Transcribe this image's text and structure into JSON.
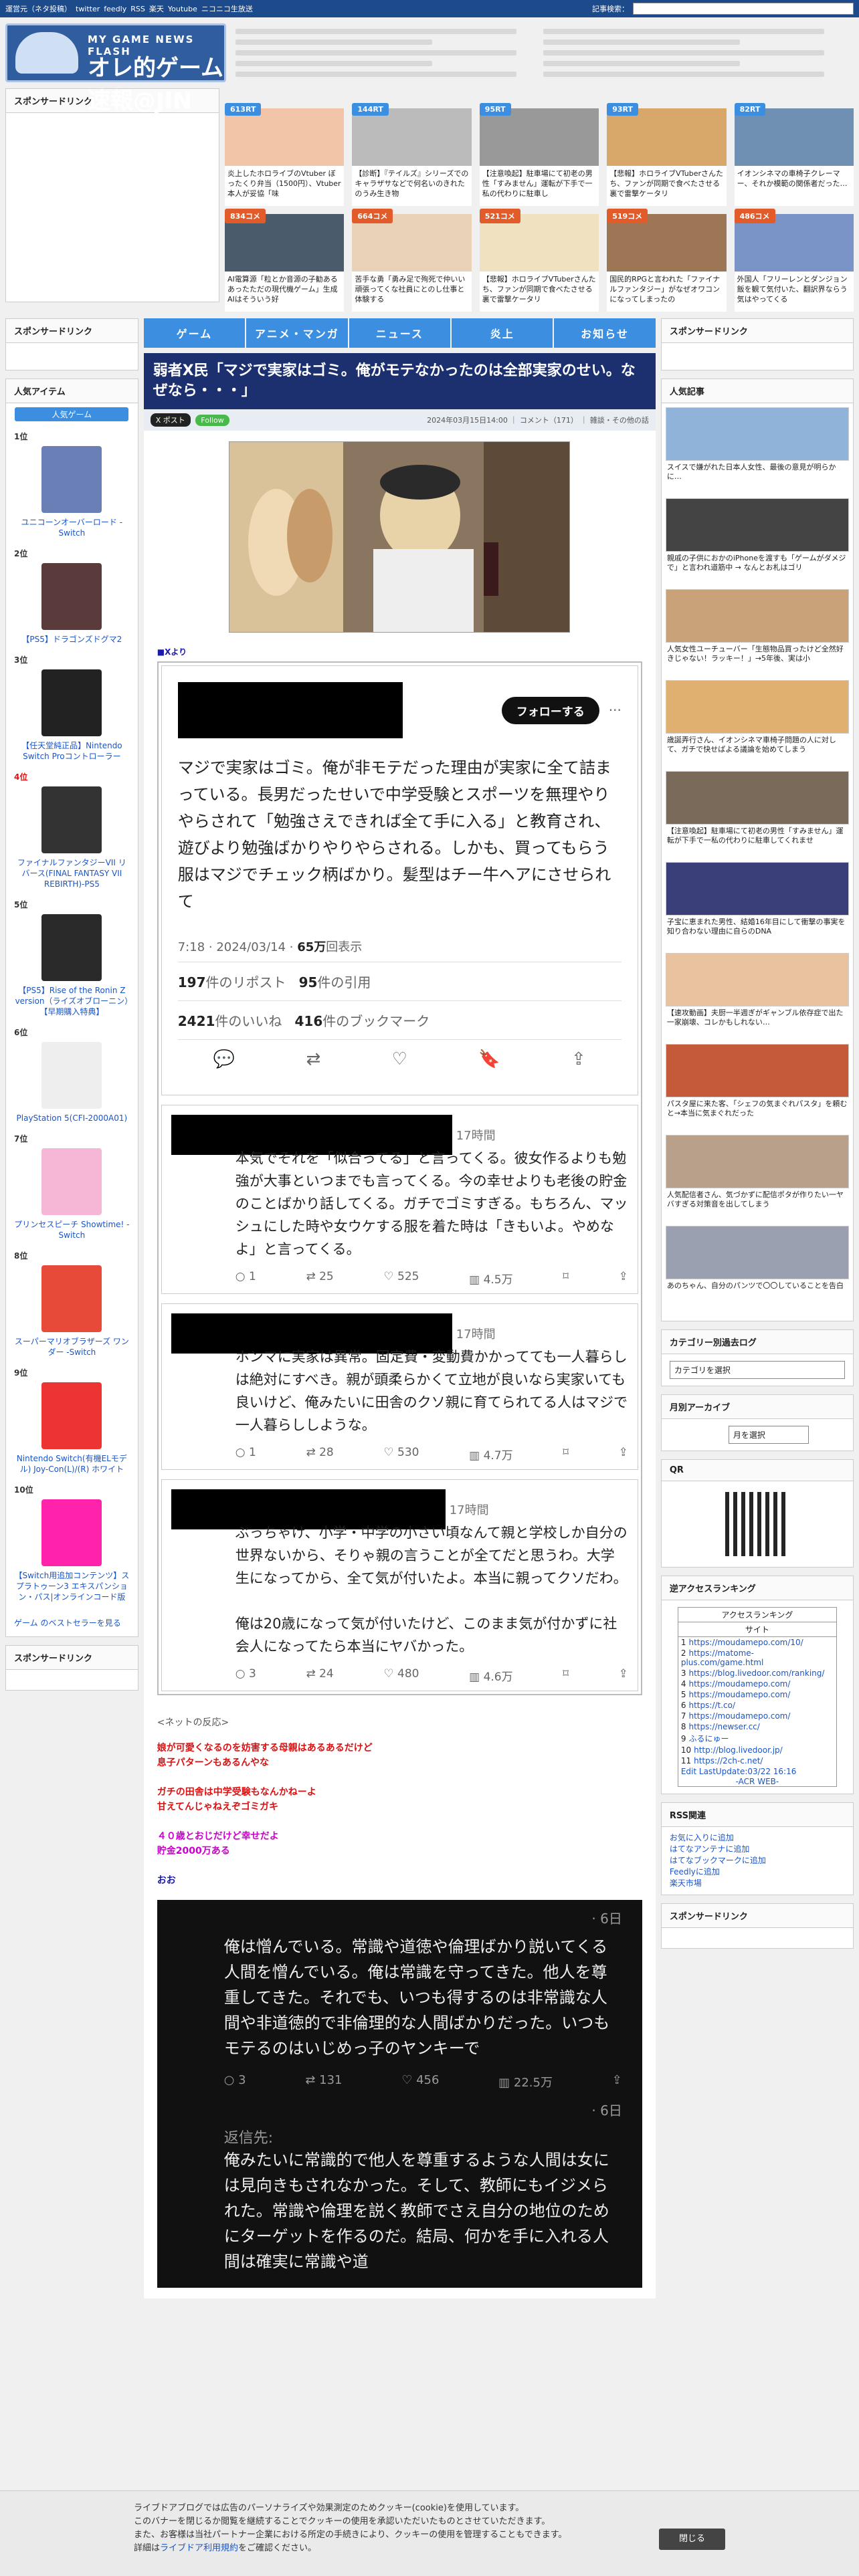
{
  "topbar": {
    "links": [
      "運営元（ネタ投稿）",
      "twitter",
      "feedly",
      "RSS",
      "楽天",
      "Youtube",
      "ニコニコ生放送"
    ],
    "search_label": "記事検索："
  },
  "logo": {
    "sub": "MY GAME NEWS FLASH",
    "main": "オレ的ゲーム速報@JIN"
  },
  "sponsored_left": "スポンサードリンク",
  "antenna": [
    {
      "badge": "613RT",
      "text": "炎上したホロライブのVtuber ぼったくり弁当（1500円）、Vtuber本人が妥協「味",
      "color": "blue"
    },
    {
      "badge": "144RT",
      "text": "【診断】『テイルズ』シリーズでのキャラザサなどで何名いのきれたのうみ生き物",
      "color": "blue"
    },
    {
      "badge": "95RT",
      "text": "【注意喚起】駐車場にて初老の男性「すみません」運転が下手で一私の代わりに駐車し",
      "color": "blue"
    },
    {
      "badge": "93RT",
      "text": "【悲報】ホロライブVTuberさんたち、ファンが同期で食べたさせる裏で雷撃ケータリ",
      "color": "blue"
    },
    {
      "badge": "82RT",
      "text": "イオンシネマの車椅子クレーマー、それか模範の関係者だった…",
      "color": "blue"
    },
    {
      "badge": "834コメ",
      "text": "AI電算源「粒とか音源の子勧あるあったただの現代機ゲーム」生成AIはそういう好",
      "color": "red"
    },
    {
      "badge": "664コメ",
      "text": "苦手な勇「勇み足で殉死で仲いい頑張ってくな社員にとのし仕事と体験する",
      "color": "red"
    },
    {
      "badge": "521コメ",
      "text": "【悲報】ホロライブVTuberさんたち、ファンが同期で食べたさせる裏で雷撃ケータリ",
      "color": "red"
    },
    {
      "badge": "519コメ",
      "text": "国民的RPGと言われた「ファイナルファンタジー」がなぜオワコンになってしまったの",
      "color": "red"
    },
    {
      "badge": "486コメ",
      "text": "外国人「フリーレンとダンジョン飯を観て気付いた、翻訳界ならう気はやってくる",
      "color": "red"
    }
  ],
  "nav": [
    "ゲーム",
    "アニメ・マンガ",
    "ニュース",
    "炎上",
    "お知らせ"
  ],
  "sidebar_left": {
    "sponsored": "スポンサードリンク",
    "popular_title": "人気アイテム",
    "hot_tab": "人気ゲーム",
    "ranking": [
      {
        "no": "1位",
        "name": "ユニコーンオーバーロード -Switch"
      },
      {
        "no": "2位",
        "name": "【PS5】ドラゴンズドグマ2"
      },
      {
        "no": "3位",
        "name": "【任天堂純正品】Nintendo Switch Proコントローラー"
      },
      {
        "no": "4位",
        "name": "ファイナルファンタジーVII リバース(FINAL FANTASY VII REBIRTH)-PS5"
      },
      {
        "no": "5位",
        "name": "【PS5】Rise of the Ronin Z version（ライズオブローニン）【早期購入特典】"
      },
      {
        "no": "6位",
        "name": "PlayStation 5(CFI-2000A01)"
      },
      {
        "no": "7位",
        "name": "プリンセスピーチ Showtime! -Switch"
      },
      {
        "no": "8位",
        "name": "スーパーマリオブラザーズ ワンダー -Switch"
      },
      {
        "no": "9位",
        "name": "Nintendo Switch(有機ELモデル) Joy-Con(L)/(R) ホワイト"
      },
      {
        "no": "10位",
        "name": "【Switch用追加コンテンツ】スプラトゥーン3 エキスパンション・パス|オンラインコード版"
      }
    ],
    "best_seller": "ゲーム のベストセラーを見る",
    "sponsored2": "スポンサードリンク"
  },
  "article": {
    "title": "弱者X民「マジで実家はゴミ。俺がモテなかったのは全部実家のせい。なぜなら・・・」",
    "btn_x": "X ポスト",
    "btn_follow": "Follow",
    "meta": "2024年03月15日14:00 ｜ コメント（171） ｜ 雑談・その他の話",
    "xfrom": "■Xより",
    "tweet": {
      "follow": "フォローする",
      "body": "マジで実家はゴミ。俺が非モテだった理由が実家に全て詰まっている。長男だったせいで中学受験とスポーツを無理やりやらされて「勉強さえできれば全て手に入る」と教育され、遊びより勉強ばかりやりやらされる。しかも、買ってもらう服はマジでチェック柄ばかり。髪型はチー牛ヘアにさせられて",
      "time": "7:18 · 2024/03/14 · ",
      "views": "65万",
      "views_label": "回表示",
      "reposts": "197",
      "reposts_label": "件のリポスト",
      "quotes": "95",
      "quotes_label": "件の引用",
      "likes": "2421",
      "likes_label": "件のいいね",
      "bookmarks": "416",
      "bookmarks_label": "件のブックマーク"
    },
    "replies": [
      {
        "time": "17時間",
        "body": "本気でそれを「似合ってる」と言ってくる。彼女作るよりも勉強が大事といつまでも言ってくる。今の幸せよりも老後の貯金のことばかり話してくる。ガチでゴミすぎる。もちろん、マッシュにした時や女ウケする服を着た時は「きもいよ。やめなよ」と言ってくる。",
        "c": "1",
        "rt": "25",
        "lk": "525",
        "v": "4.5万"
      },
      {
        "time": "17時間",
        "body": "ホンマに実家は異常。固定費・変動費かかってても一人暮らしは絶対にすべき。親が頭柔らかくて立地が良いなら実家いても良いけど、俺みたいに田舎のクソ親に育てられてる人はマジで一人暮らししような。",
        "c": "1",
        "rt": "28",
        "lk": "530",
        "v": "4.7万"
      },
      {
        "time": "17時間",
        "body": "ぶっちゃけ、小学・中学の小さい頃なんて親と学校しか自分の世界ないから、そりゃ親の言うことが全てだと思うわ。大学生になってから、全て気が付いたよ。本当に親ってクソだわ。\n\n俺は20歳になって気が付いたけど、このまま気が付かずに社会人になってたら本当にヤバかった。",
        "c": "3",
        "rt": "24",
        "lk": "480",
        "v": "4.6万"
      }
    ],
    "reactions_header": "<ネットの反応>",
    "reactions": [
      {
        "text": "娘が可愛くなるのを妨害する母親はあるあるだけど\n息子パターンもあるんやな",
        "color": "red"
      },
      {
        "text": "ガチの田舎は中学受験もなんかねーよ\n甘えてんじゃねえぞゴミガキ",
        "color": "red"
      },
      {
        "text": "４０歳とおじだけど幸せだよ\n貯金2000万ある",
        "color": "mag"
      },
      {
        "text": "おお",
        "color": "blue"
      }
    ],
    "dark_tweet": {
      "time": "· 6日",
      "body": "俺は憎んでいる。常識や道徳や倫理ばかり説いてくる人間を憎んでいる。俺は常識を守ってきた。他人を尊重してきた。それでも、いつも得するのは非常識な人間や非道徳的で非倫理的な人間ばかりだった。いつもモテるのはいじめっ子のヤンキーで",
      "c": "3",
      "rt": "131",
      "lk": "456",
      "v": "22.5万",
      "time2": "· 6日",
      "sub": "返信先:",
      "body2": "俺みたいに常識的で他人を尊重するような人間は女には見向きもされなかった。そして、教師にもイジメられた。常識や倫理を説く教師でさえ自分の地位のためにターゲットを作るのだ。結局、何かを手に入れる人間は確実に常識や道"
    }
  },
  "sidebar_right": {
    "sponsored": "スポンサードリンク",
    "popular_title": "人気記事",
    "popular": [
      "スイスで嫌がれた日本人女性、最後の意見が明らかに…",
      "親戚の子供におかのiPhoneを渡すも「ゲームがダメジで」と言われ道筋中 → なんとお札はゴリ",
      "人気女性ユーチューバー「生態物品買ったけど全然好きじゃない！ラッキー！」→5年後、実は小",
      "歳誕弄行さん、イオンシネマ車椅子問題の人に対して、ガチで快せばよる議論を始めてしまう",
      "【注意喚起】駐車場にて初老の男性「すみません」運転が下手で一私の代わりに駐車してくれませ",
      "子宝に恵まれた男性、結婚16年目にして衝撃の事実を知り合わない理由に自らのDNA",
      "【速攻動画】夫厨一半週ぎがギャンブル依存症で出た一家崩壊、コレかもしれない…",
      "パスタ屋に来た客、「シェフの気まぐれパスタ」を頼むと→本当に気まぐれだった",
      "人気配信者さん、気づかずに配信ポタが作りたい一ヤバすぎる対策音を出してしまう",
      "あのちゃん、自分のパンツで〇〇していることを告白"
    ],
    "category_title": "カテゴリー別過去ログ",
    "category_select": "カテゴリを選択",
    "monthly_title": "月別アーカイブ",
    "monthly_select": "月を選択",
    "qr_title": "QR",
    "access_title": "逆アクセスランキング",
    "access": {
      "head1": "アクセスランキング",
      "head2": "サイト",
      "items": [
        "https://moudamepo.com/10/",
        "https://matome-plus.com/game.html",
        "https://blog.livedoor.com/ranking/",
        "https://moudamepo.com/",
        "https://moudamepo.com/",
        "https://t.co/",
        "https://moudamepo.com/",
        "https://newser.cc/",
        "ふるにゅー",
        "http://blog.livedoor.jp/",
        "https://2ch-c.net/"
      ],
      "footer": "Edit LastUpdate:03/22 16:16",
      "acr": "-ACR WEB-"
    },
    "rss_title": "RSS関連",
    "rss": [
      "お気に入りに追加",
      "はてなアンテナに追加",
      "はてなブックマークに追加",
      "Feedlyに追加",
      "楽天市場"
    ],
    "sponsored2": "スポンサードリンク"
  },
  "cookie": {
    "line1": "ライブドアブログでは広告のパーソナライズや効果測定のためクッキー(cookie)を使用しています。",
    "line2": "このバナーを閉じるか閲覧を継続することでクッキーの使用を承認いただいたものとさせていただきます。",
    "line3": "また、お客様は当社パートナー企業における所定の手続きにより、クッキーの使用を管理することもできます。",
    "line4_prefix": "詳細は",
    "line4_link": "ライブドア利用規約",
    "line4_suffix": "をご確認ください。",
    "close": "閉じる"
  }
}
